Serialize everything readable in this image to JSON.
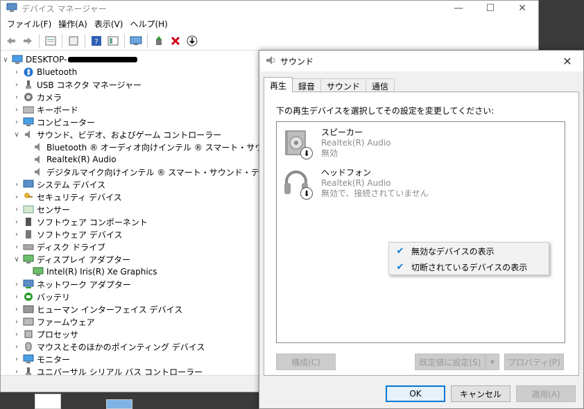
{
  "device_manager": {
    "title": "デバイス マネージャー",
    "window_controls": {
      "minimize": "—",
      "maximize": "☐",
      "close": "✕"
    },
    "menu": [
      "ファイル(F)",
      "操作(A)",
      "表示(V)",
      "ヘルプ(H)"
    ],
    "tree": {
      "root": "DESKTOP-",
      "items": [
        {
          "label": "Bluetooth",
          "expanded": false,
          "icon": "bluetooth-icon",
          "indent": 1
        },
        {
          "label": "USB コネクタ マネージャー",
          "expanded": false,
          "icon": "usb-icon",
          "indent": 1
        },
        {
          "label": "カメラ",
          "expanded": false,
          "icon": "camera-icon",
          "indent": 1
        },
        {
          "label": "キーボード",
          "expanded": false,
          "icon": "keyboard-icon",
          "indent": 1
        },
        {
          "label": "コンピューター",
          "expanded": false,
          "icon": "computer-icon",
          "indent": 1
        },
        {
          "label": "サウンド、ビデオ、およびゲーム コントローラー",
          "expanded": true,
          "icon": "speaker-icon",
          "indent": 1
        },
        {
          "label": "Bluetooth ® オーディオ向けインテル ® スマート・サウンド・テクノロ",
          "child": true,
          "icon": "speaker-icon",
          "indent": 2
        },
        {
          "label": "Realtek(R) Audio",
          "child": true,
          "icon": "speaker-icon",
          "indent": 2
        },
        {
          "label": "デジタルマイク向けインテル ® スマート・サウンド・テクノロジー",
          "child": true,
          "icon": "speaker-icon",
          "indent": 2
        },
        {
          "label": "システム デバイス",
          "expanded": false,
          "icon": "system-icon",
          "indent": 1
        },
        {
          "label": "セキュリティ デバイス",
          "expanded": false,
          "icon": "key-icon",
          "indent": 1
        },
        {
          "label": "センサー",
          "expanded": false,
          "icon": "sensor-icon",
          "indent": 1
        },
        {
          "label": "ソフトウェア コンポーネント",
          "expanded": false,
          "icon": "component-icon",
          "indent": 1
        },
        {
          "label": "ソフトウェア デバイス",
          "expanded": false,
          "icon": "device-icon",
          "indent": 1
        },
        {
          "label": "ディスク ドライブ",
          "expanded": false,
          "icon": "disk-icon",
          "indent": 1
        },
        {
          "label": "ディスプレイ アダプター",
          "expanded": true,
          "icon": "display-icon",
          "indent": 1
        },
        {
          "label": "Intel(R) Iris(R) Xe Graphics",
          "child": true,
          "icon": "display-icon",
          "indent": 2
        },
        {
          "label": "ネットワーク アダプター",
          "expanded": false,
          "icon": "network-icon",
          "indent": 1
        },
        {
          "label": "バッテリ",
          "expanded": false,
          "icon": "battery-icon",
          "indent": 1
        },
        {
          "label": "ヒューマン インターフェイス デバイス",
          "expanded": false,
          "icon": "hid-icon",
          "indent": 1
        },
        {
          "label": "ファームウェア",
          "expanded": false,
          "icon": "firmware-icon",
          "indent": 1
        },
        {
          "label": "プロセッサ",
          "expanded": false,
          "icon": "cpu-icon",
          "indent": 1
        },
        {
          "label": "マウスとそのほかのポインティング デバイス",
          "expanded": false,
          "icon": "mouse-icon",
          "indent": 1
        },
        {
          "label": "モニター",
          "expanded": false,
          "icon": "monitor-icon",
          "indent": 1
        },
        {
          "label": "ユニバーサル シリアル バス コントローラー",
          "expanded": false,
          "icon": "usb-icon",
          "indent": 1
        }
      ]
    }
  },
  "sound_dialog": {
    "title": "サウンド",
    "close": "✕",
    "tabs": [
      "再生",
      "録音",
      "サウンド",
      "通信"
    ],
    "instruction": "下の再生デバイスを選択してその設定を変更してください:",
    "devices": [
      {
        "name": "スピーカー",
        "driver": "Realtek(R) Audio",
        "status": "無効",
        "icon": "speaker-device-icon"
      },
      {
        "name": "ヘッドフォン",
        "driver": "Realtek(R) Audio",
        "status": "無効で、接続されていません",
        "icon": "headphones-icon"
      }
    ],
    "context_menu": [
      {
        "label": "無効なデバイスの表示",
        "checked": true
      },
      {
        "label": "切断されているデバイスの表示",
        "checked": true
      }
    ],
    "buttons": {
      "configure": "構成(C)",
      "set_default": "既定値に設定(S)",
      "properties": "プロパティ(P)",
      "ok": "OK",
      "cancel": "キャンセル",
      "apply": "適用(A)"
    }
  },
  "colors": {
    "accent": "#0078d7",
    "disabled_text": "#9a9a9a",
    "delete_red": "#d0021b"
  }
}
